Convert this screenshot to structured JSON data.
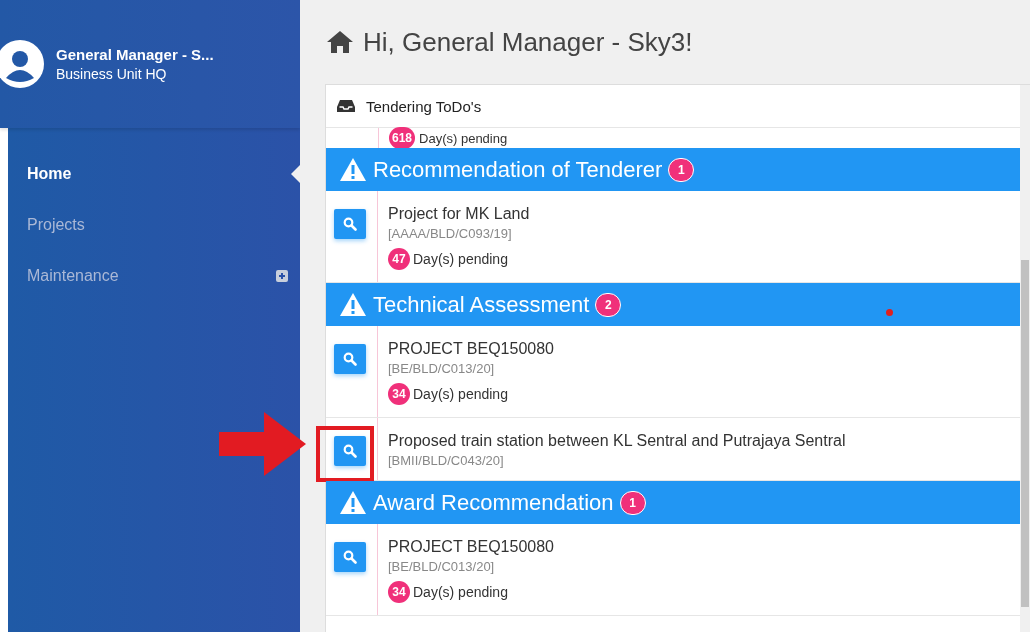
{
  "sidebar": {
    "user": {
      "name": "General Manager - S...",
      "unit": "Business Unit HQ"
    },
    "items": [
      {
        "label": "Home",
        "selected": true,
        "expandable": false
      },
      {
        "label": "Projects",
        "selected": false,
        "expandable": false
      },
      {
        "label": "Maintenance",
        "selected": false,
        "expandable": true
      }
    ]
  },
  "greeting": "Hi, General Manager - Sky3!",
  "card": {
    "title": "Tendering ToDo's",
    "partial_row": {
      "days": "618",
      "pending": "Day(s) pending"
    },
    "sections": [
      {
        "title": "Recommendation of Tenderer",
        "count": "1",
        "marked": false,
        "items": [
          {
            "title": "Project for MK Land",
            "ref": "[AAAA/BLD/C093/19]",
            "days": "47",
            "pending": "Day(s) pending",
            "highlighted": false
          }
        ]
      },
      {
        "title": "Technical Assessment",
        "count": "2",
        "marked": true,
        "items": [
          {
            "title": "PROJECT BEQ150080",
            "ref": "[BE/BLD/C013/20]",
            "days": "34",
            "pending": "Day(s) pending",
            "highlighted": false
          },
          {
            "title": "Proposed train station between KL Sentral and Putrajaya Sentral",
            "ref": "[BMII/BLD/C043/20]",
            "highlighted": true
          }
        ]
      },
      {
        "title": "Award Recommendation",
        "count": "1",
        "marked": false,
        "items": [
          {
            "title": "PROJECT BEQ150080",
            "ref": "[BE/BLD/C013/20]",
            "days": "34",
            "pending": "Day(s) pending",
            "highlighted": false
          }
        ]
      }
    ]
  }
}
